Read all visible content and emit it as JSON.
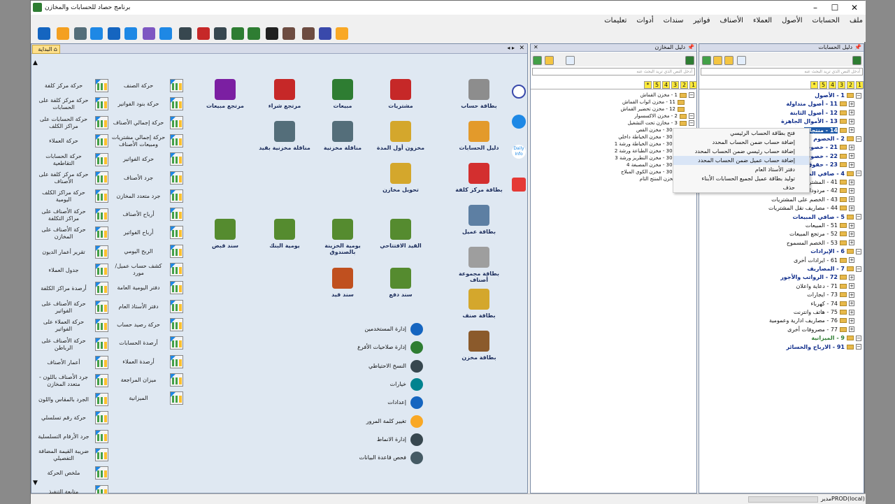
{
  "window": {
    "title": "برنامج حصاد للحسابات والمخازن"
  },
  "menu": [
    "ملف",
    "الحسابات",
    "الأصول",
    "العملاء",
    "الأصناف",
    "فواتير",
    "سندات",
    "أدوات",
    "تعليمات"
  ],
  "accounts_pane": {
    "title": "دليل الحسابات",
    "search_placeholder": "أدخل النص الذي تريد البحث عنه",
    "levels": [
      "1",
      "2",
      "3",
      "4",
      "5",
      "*"
    ],
    "tree": [
      {
        "code": "1",
        "name": "الأصول",
        "indent": 0,
        "style": "b"
      },
      {
        "code": "11",
        "name": "أصول متداولة",
        "indent": 1,
        "style": "b"
      },
      {
        "code": "12",
        "name": "أصول الثابتة",
        "indent": 1,
        "style": "b"
      },
      {
        "code": "13",
        "name": "الأموال الجاهزة",
        "indent": 1,
        "style": "b"
      },
      {
        "code": "14",
        "name": "منتجات",
        "indent": 1,
        "style": "sel"
      },
      {
        "code": "2",
        "name": "الخصوم",
        "indent": 0,
        "style": "b"
      },
      {
        "code": "21",
        "name": "خصوم م",
        "indent": 1,
        "style": "b"
      },
      {
        "code": "22",
        "name": "خصوم ث",
        "indent": 1,
        "style": "b"
      },
      {
        "code": "23",
        "name": "حقوق ال",
        "indent": 1,
        "style": "b"
      },
      {
        "code": "4",
        "name": "صافي المشا",
        "indent": 0,
        "style": "b"
      },
      {
        "code": "41",
        "name": "المشتر",
        "indent": 1,
        "style": ""
      },
      {
        "code": "42",
        "name": "مردودات",
        "indent": 1,
        "style": ""
      },
      {
        "code": "43",
        "name": "الخصم على المشتريات",
        "indent": 1,
        "style": ""
      },
      {
        "code": "44",
        "name": "مصاريف نقل المشتريات",
        "indent": 1,
        "style": ""
      },
      {
        "code": "5",
        "name": "صافي المبيعات",
        "indent": 0,
        "style": "b"
      },
      {
        "code": "51",
        "name": "المبيعات",
        "indent": 1,
        "style": ""
      },
      {
        "code": "52",
        "name": "مرتجع المبيعات",
        "indent": 1,
        "style": ""
      },
      {
        "code": "53",
        "name": "الخصم المسموح",
        "indent": 1,
        "style": ""
      },
      {
        "code": "6",
        "name": "الإيرادات",
        "indent": 0,
        "style": "b"
      },
      {
        "code": "61",
        "name": "ايرادات أخرى",
        "indent": 1,
        "style": ""
      },
      {
        "code": "7",
        "name": "المصاريف",
        "indent": 0,
        "style": "b"
      },
      {
        "code": "72",
        "name": "الرواتب والأجور",
        "indent": 1,
        "style": "b"
      },
      {
        "code": "71",
        "name": "دعاية واعلان",
        "indent": 1,
        "style": ""
      },
      {
        "code": "73",
        "name": "ايجارات",
        "indent": 1,
        "style": ""
      },
      {
        "code": "74",
        "name": "كهرباء",
        "indent": 1,
        "style": ""
      },
      {
        "code": "75",
        "name": "هاتف وانترنت",
        "indent": 1,
        "style": ""
      },
      {
        "code": "76",
        "name": "مصاريف ادارية وعمومية",
        "indent": 1,
        "style": ""
      },
      {
        "code": "77",
        "name": "مصروفات أخرى",
        "indent": 1,
        "style": ""
      },
      {
        "code": "9",
        "name": "الميزانية",
        "indent": 0,
        "style": "g"
      },
      {
        "code": "91",
        "name": "الارباح والخسائر",
        "indent": 0,
        "style": "b"
      }
    ]
  },
  "context_menu": [
    "فتح بطاقة الحساب الرئيسي",
    "إضافة حساب ضمن الحساب المحدد",
    "إضافة حساب رئيسي ضمن الحساب المحدد",
    "إضافة حساب عميل ضمن الحساب المحدد",
    "دفتر الأستاذ العام",
    "توليد بطاقة عميل لجميع الحسابات الأبناء",
    "حذف"
  ],
  "stores_pane": {
    "title": "دليل المخازن",
    "search_placeholder": "أدخل النص الذي تريد البحث عنه",
    "levels": [
      "1",
      "2",
      "3",
      "4",
      "5",
      "*"
    ],
    "tree": [
      {
        "code": "1",
        "name": "مخزن القماش",
        "indent": 0
      },
      {
        "code": "11",
        "name": "مخزن اثواب القماش",
        "indent": 1
      },
      {
        "code": "12",
        "name": "مخزن تحضير القماش",
        "indent": 1
      },
      {
        "code": "2",
        "name": "مخزن الاكسسوار",
        "indent": 0
      },
      {
        "code": "3",
        "name": "مخازن تحت التشغيل",
        "indent": 0
      },
      {
        "code": "301",
        "name": "مخزن القص",
        "indent": 1
      },
      {
        "code": "302",
        "name": "مخزن الخياطة داخلي",
        "indent": 1
      },
      {
        "code": "303",
        "name": "مخزن الخياطة ورشة 1",
        "indent": 1
      },
      {
        "code": "304",
        "name": "مخزن الطباعة ورشة 2",
        "indent": 1
      },
      {
        "code": "305",
        "name": "مخزن التطريز ورشة 3",
        "indent": 1
      },
      {
        "code": "306",
        "name": "مخزن المصبغة 4",
        "indent": 1
      },
      {
        "code": "307",
        "name": "مخزن الكوي المبلاج",
        "indent": 1
      },
      {
        "code": "",
        "name": "مخزن المنتج التام",
        "indent": 1
      }
    ]
  },
  "main": {
    "tab": "البداية",
    "cards": [
      {
        "label": "بطاقة حساب",
        "color": "#8d8d8d"
      },
      {
        "label": "دليل الحسابات",
        "color": "#e39a2b"
      },
      {
        "label": "بطاقة مركز كلفة",
        "color": "#d32f2f"
      },
      {
        "label": "بطاقة عميل",
        "color": "#5d7fa3"
      },
      {
        "label": "بطاقة مجموعة أصناف",
        "color": "#9e9e9e"
      },
      {
        "label": "بطاقة صنف",
        "color": "#d4a72c"
      },
      {
        "label": "بطاقة مخزن",
        "color": "#8b5a2b"
      },
      {
        "label": "مشتريات",
        "color": "#c62828"
      },
      {
        "label": "مبيعات",
        "color": "#2e7d32"
      },
      {
        "label": "مرتجع شراء",
        "color": "#c62828"
      },
      {
        "label": "مرتجع مبيعات",
        "color": "#7b1fa2"
      },
      {
        "label": "مخزون أول المدة",
        "color": "#d4a72c"
      },
      {
        "label": "مناقلة مخزنية",
        "color": "#546e7a"
      },
      {
        "label": "مناقلة مخزنية بقيد",
        "color": "#546e7a"
      },
      {
        "label": "تحويل مخازن",
        "color": "#d4a72c"
      },
      {
        "label": "القيد الافتتاحي",
        "color": "#558b2f"
      },
      {
        "label": "يومية الخزينة بالصندوق",
        "color": "#558b2f"
      },
      {
        "label": "يومية البنك",
        "color": "#558b2f"
      },
      {
        "label": "سند قبض",
        "color": "#558b2f"
      },
      {
        "label": "سند دفع",
        "color": "#558b2f"
      },
      {
        "label": "سند قيد",
        "color": "#c0501f"
      }
    ],
    "admin": [
      {
        "label": "إدارة المستخدمين",
        "color": "#1565c0"
      },
      {
        "label": "إدارة صلاحيات الأفرع",
        "color": "#2e7d32"
      },
      {
        "label": "النسخ الاحتياطي",
        "color": "#37474f"
      },
      {
        "label": "خيارات",
        "color": "#00838f"
      },
      {
        "label": "إعدادات",
        "color": "#1565c0"
      },
      {
        "label": "تغيير كلمة المرور",
        "color": "#f9a825"
      },
      {
        "label": "إدارة الانماط",
        "color": "#37474f"
      },
      {
        "label": "فحص قاعدة البيانات",
        "color": "#455a64"
      }
    ],
    "reports_col1": [
      "حركة الصنف",
      "حركة بنود الفواتير",
      "حركة إجمالي الأصناف",
      "حركة إجمالي مشتريات ومبيعات الأصناف",
      "حركة الفواتير",
      "جرد الأصناف",
      "جرد متعدد المخازن",
      "أرباح الأصناف",
      "أرباح الفواتير",
      "الربح اليومي",
      "كشف حساب عميل/مورد",
      "دفتر اليومية العامة",
      "دفتر الأستاذ العام",
      "حركة رصيد حساب",
      "أرصدة الحسابات",
      "أرصدة العملاء",
      "ميزان المراجعة",
      "الميزانية"
    ],
    "reports_col2": [
      "حركة مركز كلفة",
      "حركة مركز كلفة على الحسابات",
      "حركة الحسابات على مراكز الكلف",
      "حركة العملاء",
      "حركة الحسابات التقاطعية",
      "حركة مركز كلفة على الأصناف",
      "حركة مراكز الكلف اليومية",
      "حركة الأصناف على مراكز التكلفة",
      "حركة الأصناف على المخازن",
      "تقرير أعمار الديون",
      "جدول العملاء",
      "أرصدة مراكز الكلفة",
      "حركة الأصناف على الفواتير",
      "حركة العملاء على الفواتير",
      "حركة الأصناف على الرباطن",
      "أعمار الأصناف",
      "جرد الأصناف باللون - متعدد المخازن",
      "الجرد بالمقاس واللون",
      "حركة رقم تسلسلي",
      "جرد الأرقام التسلسلية",
      "ضريبة القيمة المضافة التفصيلي",
      "ملخص الحركة",
      "متابعة التنفيذ"
    ],
    "side": [
      "Daily Info"
    ]
  },
  "status": {
    "user": "مدير",
    "db": "PROD",
    "server": "(local)"
  }
}
